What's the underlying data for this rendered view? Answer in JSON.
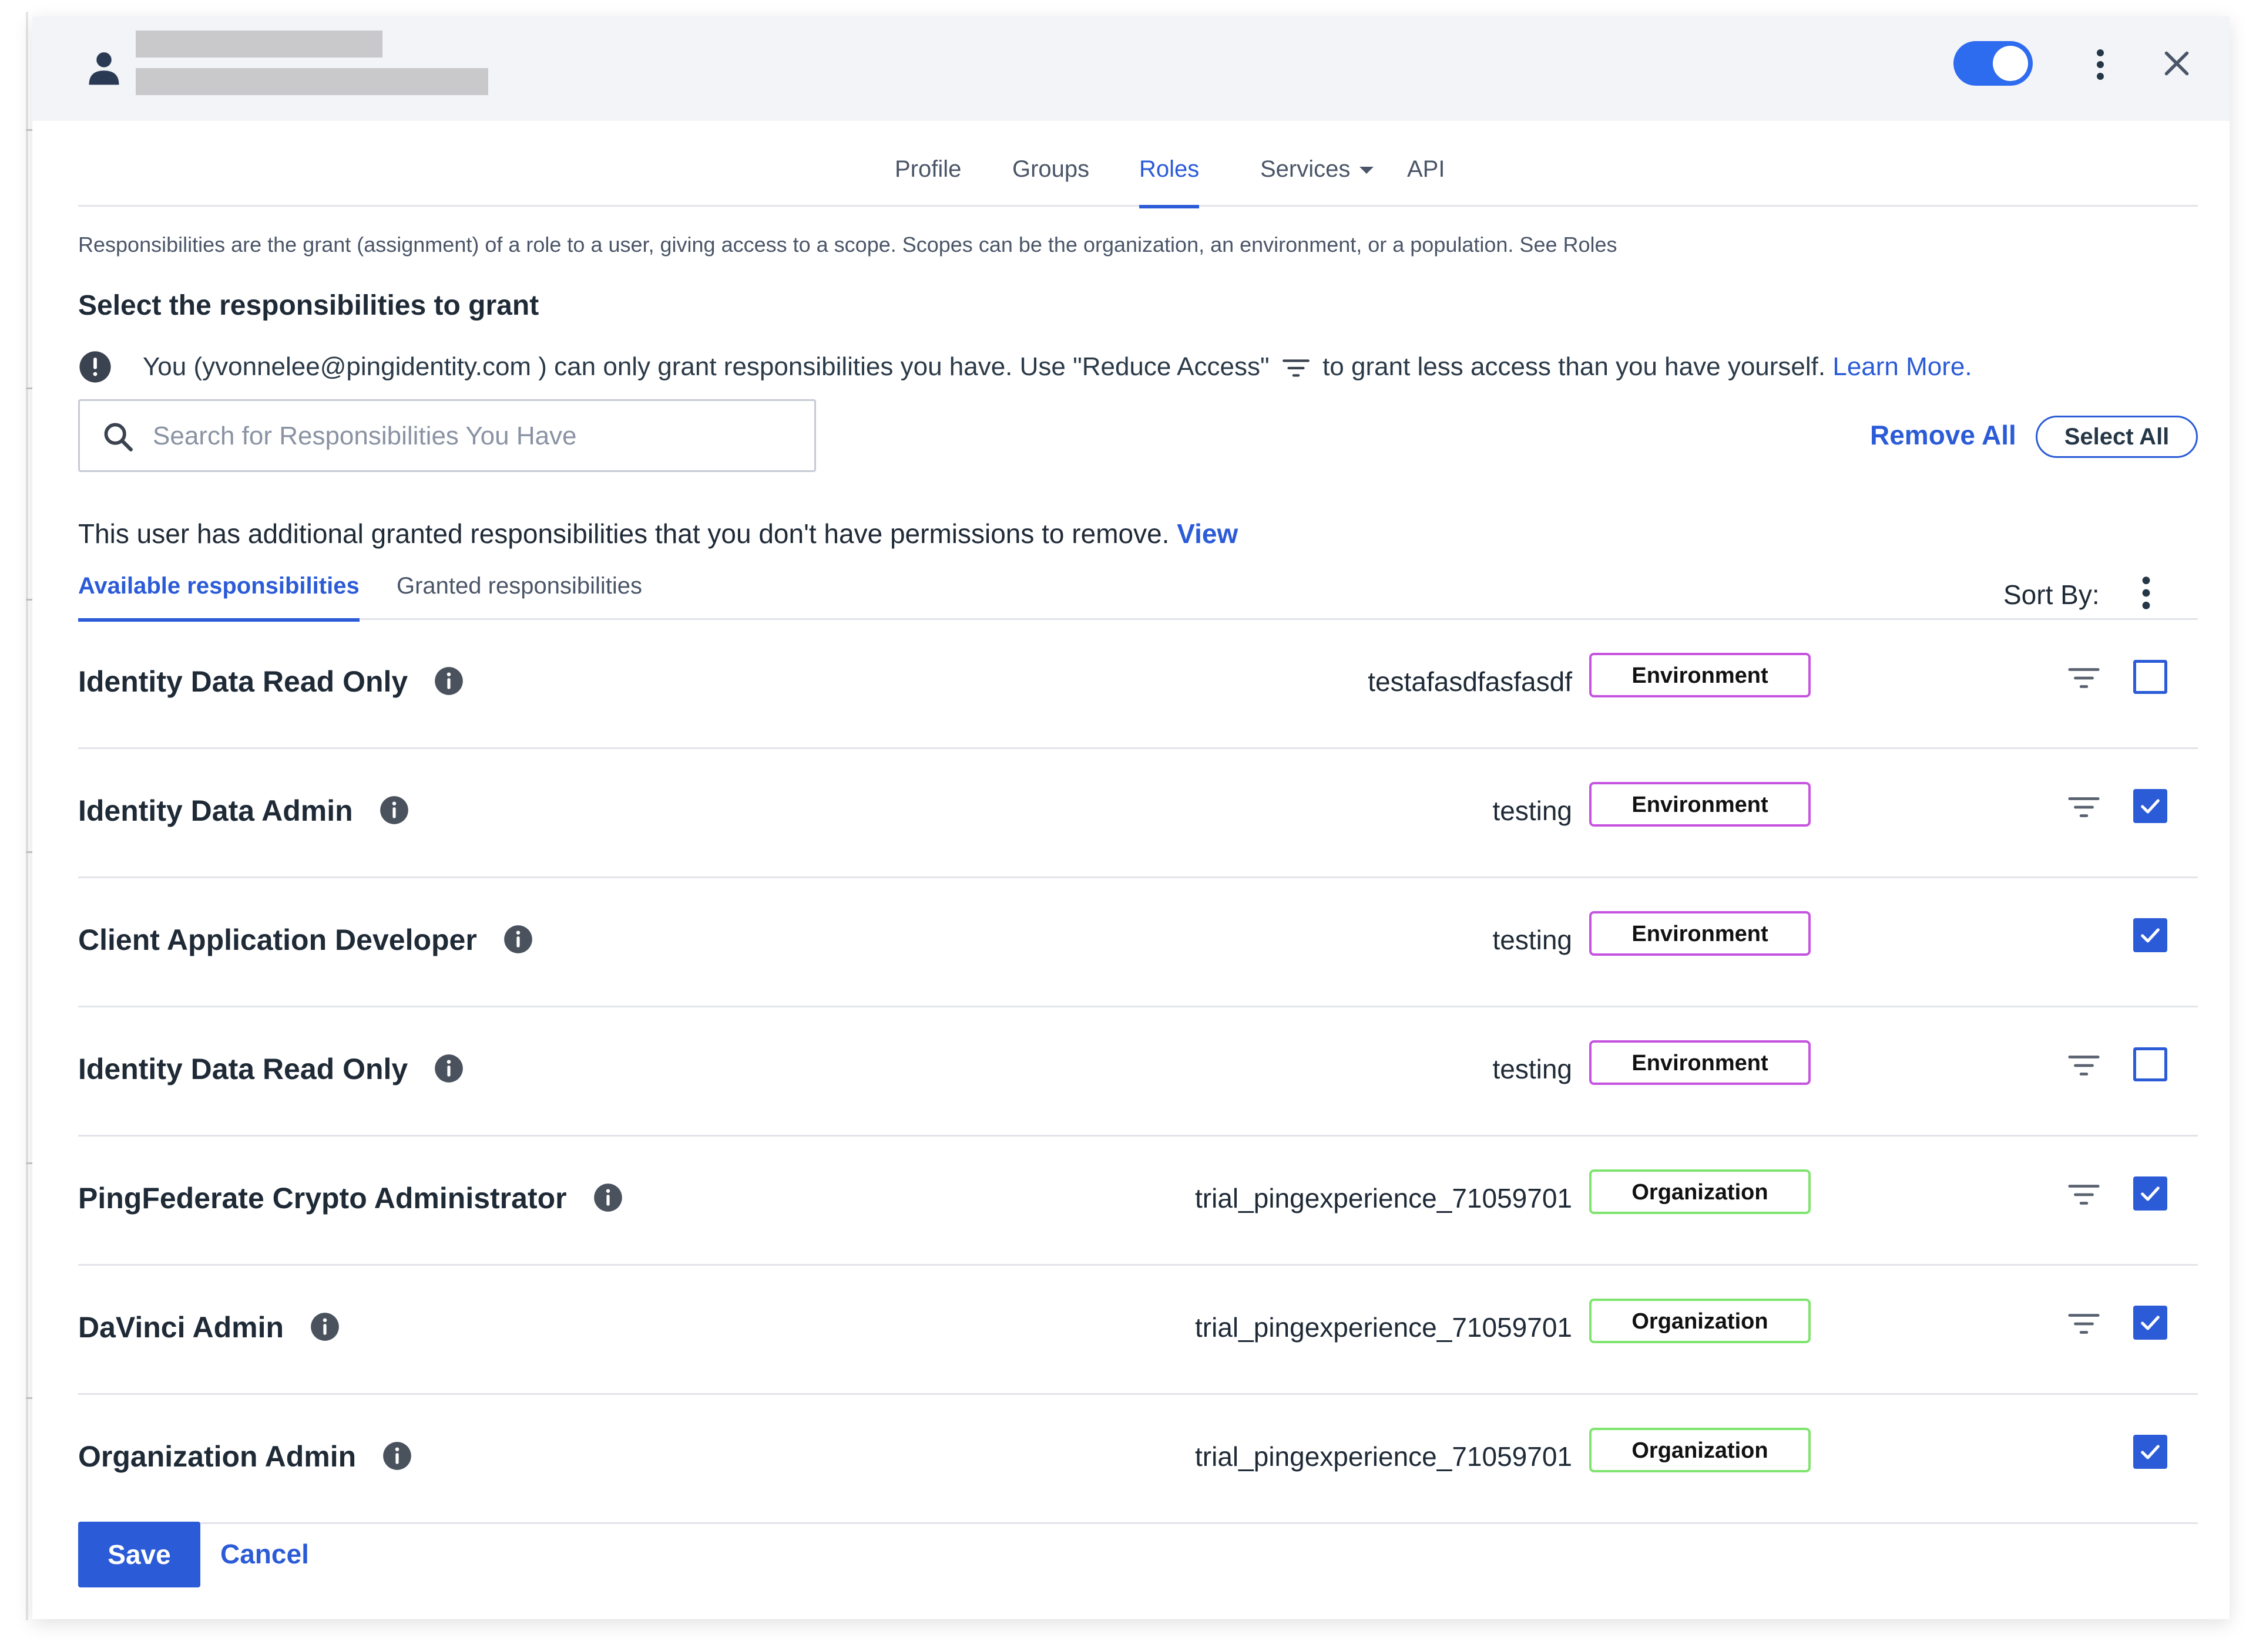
{
  "tabs": [
    "Profile",
    "Groups",
    "Roles",
    "Services",
    "API"
  ],
  "description": "Responsibilities are the grant (assignment) of a role to a user, giving access to a scope. Scopes can be the organization, an environment, or a population. See Roles",
  "section_title": "Select the responsibilities to grant",
  "warning": {
    "text_before": "You (yvonnelee@pingidentity.com ) can only grant responsibilities you have. Use \"Reduce Access\"",
    "text_after": "to grant less access than you have yourself.",
    "link": "Learn More."
  },
  "search": {
    "placeholder": "Search for Responsibilities You Have",
    "value": ""
  },
  "actions": {
    "remove_all": "Remove All",
    "select_all": "Select All"
  },
  "additional_notice": {
    "text": "This user has additional granted responsibilities that you don't have permissions to remove.",
    "link": "View"
  },
  "sub_tabs": [
    "Available responsibilities",
    "Granted responsibilities"
  ],
  "sort_label": "Sort By:",
  "rows": [
    {
      "name": "Identity Data Read Only",
      "scope": "testafasdfasfasdf",
      "badge": "Environment",
      "checked": false,
      "filter": true
    },
    {
      "name": "Identity Data Admin",
      "scope": "testing",
      "badge": "Environment",
      "checked": true,
      "filter": true
    },
    {
      "name": "Client Application Developer",
      "scope": "testing",
      "badge": "Environment",
      "checked": true,
      "filter": false
    },
    {
      "name": "Identity Data Read Only",
      "scope": "testing",
      "badge": "Environment",
      "checked": false,
      "filter": true
    },
    {
      "name": "PingFederate Crypto Administrator",
      "scope": "trial_pingexperience_71059701",
      "badge": "Organization",
      "checked": true,
      "filter": true
    },
    {
      "name": "DaVinci Admin",
      "scope": "trial_pingexperience_71059701",
      "badge": "Organization",
      "checked": true,
      "filter": true
    },
    {
      "name": "Organization Admin",
      "scope": "trial_pingexperience_71059701",
      "badge": "Organization",
      "checked": true,
      "filter": false
    }
  ],
  "footer": {
    "save": "Save",
    "cancel": "Cancel"
  },
  "colors": {
    "accent": "#2b5bd7",
    "toggle": "#2d6bef",
    "environment_badge": "#c653e0",
    "organization_badge": "#7ee46e"
  },
  "icons": [
    "user-icon",
    "toggle-switch",
    "kebab-menu-icon",
    "close-icon",
    "warning-icon",
    "filter-icon",
    "search-icon",
    "info-icon",
    "checkbox"
  ],
  "toggle_on": true
}
